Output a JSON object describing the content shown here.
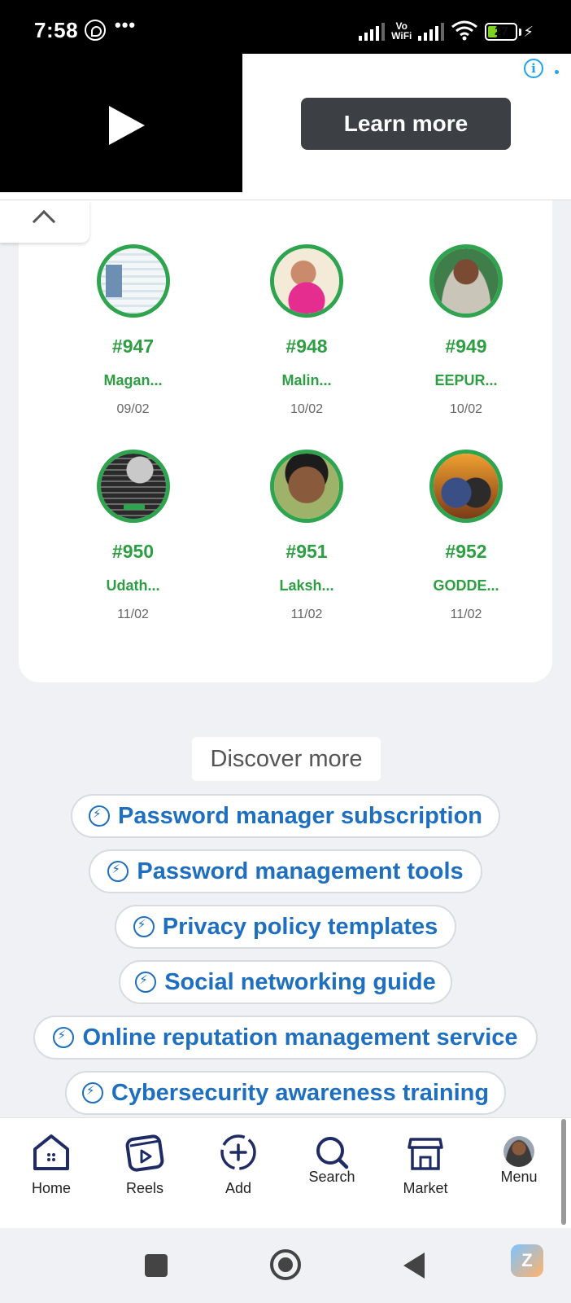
{
  "status_bar": {
    "time": "7:58",
    "dots": "•••",
    "network_label_top": "Vo",
    "network_label_bottom": "WiFi",
    "battery": "27"
  },
  "ad": {
    "cta_label": "Learn more",
    "info_glyph": "i"
  },
  "members": [
    {
      "number": "#947",
      "name": "Magan...",
      "date": "09/02"
    },
    {
      "number": "#948",
      "name": "Malin...",
      "date": "10/02"
    },
    {
      "number": "#949",
      "name": "EEPUR...",
      "date": "10/02"
    },
    {
      "number": "#950",
      "name": "Udath...",
      "date": "11/02"
    },
    {
      "number": "#951",
      "name": "Laksh...",
      "date": "11/02"
    },
    {
      "number": "#952",
      "name": "GODDE...",
      "date": "11/02"
    }
  ],
  "discover": {
    "label": "Discover more",
    "chips": [
      "Password manager subscription",
      "Password management tools",
      "Privacy policy templates",
      "Social networking guide",
      "Online reputation management service",
      "Cybersecurity awareness training"
    ]
  },
  "bottom_nav": {
    "items": [
      "Home",
      "Reels",
      "Add",
      "Search",
      "Market",
      "Menu"
    ]
  },
  "android_nav": {
    "app_badge": "Z"
  },
  "colors": {
    "accent_green": "#2e9e43",
    "link_blue": "#1e6fbf"
  }
}
